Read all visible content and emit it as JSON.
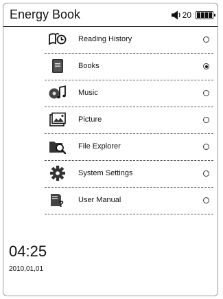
{
  "header": {
    "title": "Energy Book",
    "volume": "20",
    "speaker_icon": "speaker-icon",
    "battery_icon": "battery-icon"
  },
  "menu": {
    "items": [
      {
        "label": "Reading History",
        "icon": "reading-history-icon",
        "selected": false
      },
      {
        "label": "Books",
        "icon": "books-icon",
        "selected": true
      },
      {
        "label": "Music",
        "icon": "music-icon",
        "selected": false
      },
      {
        "label": "Picture",
        "icon": "picture-icon",
        "selected": false
      },
      {
        "label": "File Explorer",
        "icon": "file-explorer-icon",
        "selected": false
      },
      {
        "label": "System Settings",
        "icon": "settings-gear-icon",
        "selected": false
      },
      {
        "label": "User Manual",
        "icon": "user-manual-icon",
        "selected": false
      }
    ]
  },
  "footer": {
    "time": "04:25",
    "date": "2010,01,01"
  }
}
